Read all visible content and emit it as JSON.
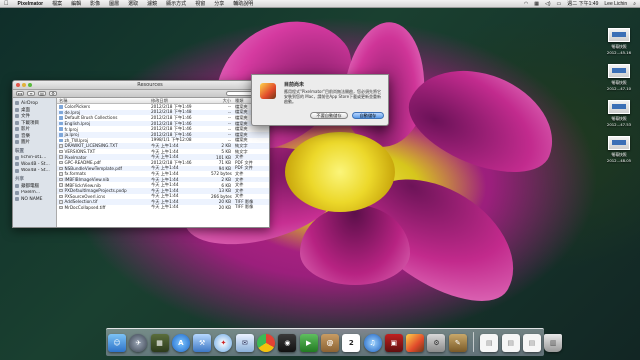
{
  "menubar": {
    "app_name": "Pixelmator",
    "items": [
      "檔案",
      "編輯",
      "影像",
      "圖層",
      "選取",
      "濾鏡",
      "顯示方式",
      "視窗",
      "分享",
      "輔助說明"
    ],
    "clock": "週二 下午1:49",
    "user": "Lee Lichin"
  },
  "finder": {
    "title": "Resources",
    "sidebar": {
      "favorites": [
        "AirDrop",
        "桌面",
        "文件",
        "下載項目",
        "影片",
        "音樂",
        "圖片"
      ],
      "devices_head": "裝置",
      "devices": [
        "lichin-ot1...",
        "Wox4B - St...",
        "Wox4B - St..."
      ],
      "shared_head": "共享",
      "shared": [
        "蘋都電腦",
        "Pixelm... ",
        "NO NAME"
      ]
    },
    "columns": {
      "name": "名稱",
      "date": "修改日期",
      "size": "大小",
      "kind": "種類"
    },
    "files": [
      {
        "name": "ColorPickers",
        "date": "2012/2/18 下午1:49",
        "size": "--",
        "kind": "檔案夾",
        "type": "folder"
      },
      {
        "name": "de.lproj",
        "date": "2012/2/18 下午1:48",
        "size": "--",
        "kind": "檔案夾",
        "type": "folder"
      },
      {
        "name": "Default Brush Collections",
        "date": "2012/2/18 下午1:46",
        "size": "--",
        "kind": "檔案夾",
        "type": "folder"
      },
      {
        "name": "English.lproj",
        "date": "2012/2/18 下午1:46",
        "size": "--",
        "kind": "檔案夾",
        "type": "folder"
      },
      {
        "name": "fr.lproj",
        "date": "2012/2/18 下午1:46",
        "size": "--",
        "kind": "檔案夾",
        "type": "folder"
      },
      {
        "name": "ja.lproj",
        "date": "2012/2/18 下午1:46",
        "size": "--",
        "kind": "檔案夾",
        "type": "folder"
      },
      {
        "name": "zh_TW.lproj",
        "date": "1998/1/1 下午12:08",
        "size": "--",
        "kind": "檔案夾",
        "type": "folder"
      },
      {
        "name": "DRAWKIT_LICENSING.TXT",
        "date": "今天 上午1:44",
        "size": "2 KB",
        "kind": "純文字",
        "type": "doc"
      },
      {
        "name": "VERSIONS.TXT",
        "date": "今天 上午1:44",
        "size": "5 KB",
        "kind": "純文字",
        "type": "doc"
      },
      {
        "name": "Pixelmator",
        "date": "今天 上午1:44",
        "size": "101 KB",
        "kind": "文件",
        "type": "doc"
      },
      {
        "name": "GPC-README.pdf",
        "date": "2012/2/18 下午1:46",
        "size": "71 KB",
        "kind": "PDF 文件",
        "type": "doc"
      },
      {
        "name": "NSBundleViewTemplate.pdf",
        "date": "今天 上午1:44",
        "size": "94 KB",
        "kind": "PDF 文件",
        "type": "doc"
      },
      {
        "name": "fx.formats",
        "date": "今天 上午1:44",
        "size": "572 bytes",
        "kind": "文件",
        "type": "doc"
      },
      {
        "name": "IMBFlBImageView.nib",
        "date": "今天 上午1:44",
        "size": "2 KB",
        "kind": "文件",
        "type": "doc"
      },
      {
        "name": "IMBFlickrView.nib",
        "date": "今天 上午1:44",
        "size": "6 KB",
        "kind": "文件",
        "type": "doc"
      },
      {
        "name": "PXDefaultImageProjects.pxdp",
        "date": "今天 上午1:44",
        "size": "13 KB",
        "kind": "文件",
        "type": "doc"
      },
      {
        "name": "PXSourceOverl.icns",
        "date": "今天 上午1:44",
        "size": "266 bytes",
        "kind": "文件",
        "type": "doc"
      },
      {
        "name": "AddSelection.tif",
        "date": "今天 上午1:44",
        "size": "20 KB",
        "kind": "TIFF 影像",
        "type": "doc"
      },
      {
        "name": "MrDocCollapsed.tiff",
        "date": "今天 上午1:44",
        "size": "20 KB",
        "kind": "TIFF 影像",
        "type": "doc"
      }
    ]
  },
  "dialog": {
    "title": "目前尚未",
    "message": "應用程式\"Pixelmator\"目前尚無法開啟，您必須先將它安裝到您的 Mac，請前往App Store下載或更新並重新啟動。",
    "cancel_label": "不要自動儲存",
    "ok_label": "自動儲存"
  },
  "desktop_icons": [
    {
      "line1": "螢幕快照",
      "line2": "2012...45.16"
    },
    {
      "line1": "螢幕快照",
      "line2": "2012...47.10"
    },
    {
      "line1": "螢幕快照",
      "line2": "2012...47.53"
    },
    {
      "line1": "螢幕快照",
      "line2": "2012...48.05"
    }
  ],
  "dock": {
    "calendar_day": "2",
    "icon_names": [
      "finder-icon",
      "launchpad-icon",
      "mission-control-icon",
      "app-store-icon",
      "xcode-icon",
      "safari-icon",
      "mail-icon",
      "chrome-icon",
      "photo-booth-icon",
      "facetime-icon",
      "contacts-icon",
      "calendar-icon",
      "itunes-icon",
      "photo-icon",
      "pixelmator-icon",
      "preview-icon",
      "system-preferences-icon",
      "document-icon",
      "document-icon-2",
      "downloads-icon",
      "trash-icon"
    ]
  }
}
